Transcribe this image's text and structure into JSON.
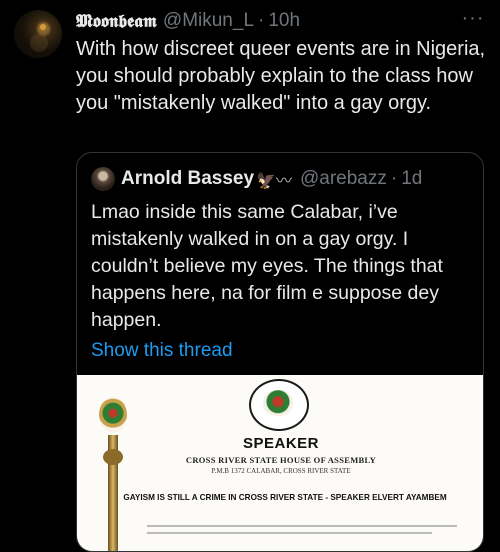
{
  "tweet": {
    "author_name": "𝕸𝖔𝖔𝖓𝖇𝖊𝖆𝖒",
    "author_handle": "@Mikun_L",
    "separator": "·",
    "time": "10h",
    "text": "With how discreet queer events are in Nigeria, you should probably explain to the class how you \"mistakenly walked\" into a gay orgy.",
    "more_label": "···"
  },
  "quoted": {
    "author_name": "Arnold Bassey",
    "author_emoji": "🦅〰",
    "author_handle": "@arebazz",
    "separator": "·",
    "time": "1d",
    "text": "Lmao inside this same Calabar, i’ve mistakenly walked in on a gay orgy. I couldn’t believe my eyes. The things that happens here, na for film e suppose dey happen.",
    "show_thread": "Show this thread",
    "image": {
      "title": "SPEAKER",
      "assembly": "CROSS RIVER STATE HOUSE OF ASSEMBLY",
      "address": "P.M.B 1372 CALABAR, CROSS RIVER STATE",
      "headline": "GAYISM IS STILL A CRIME IN CROSS RIVER STATE - SPEAKER ELVERT AYAMBEM"
    }
  },
  "colors": {
    "background": "#000000",
    "text_primary": "#e7e9ea",
    "text_secondary": "#71767b",
    "link": "#1d9bf0",
    "border": "#2f3336"
  },
  "icons": {
    "more": "more-horizontal-icon"
  }
}
